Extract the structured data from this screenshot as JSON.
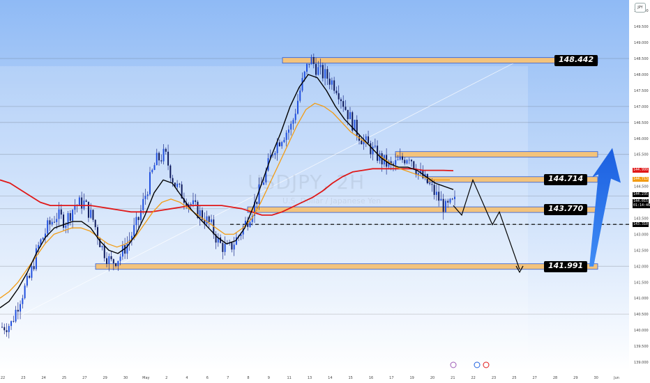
{
  "symbol": "USDJPY, 2H",
  "watermark_sub": "U.S. Dollar / Japanese Yen",
  "currency": "JPY",
  "colors": {
    "bg_top": "#8fbaf5",
    "bg_bottom": "#ffffff",
    "ma_red": "#e01818",
    "ma_orange": "#f39c12",
    "ma_black": "#000000",
    "candle": "#1a2a8a",
    "zone": "#f3c37c",
    "arrow": "#2e7df0"
  },
  "price_axis": [
    "150.000",
    "149.500",
    "149.000",
    "148.500",
    "148.000",
    "147.500",
    "147.000",
    "146.500",
    "146.000",
    "145.500",
    "145.000",
    "144.500",
    "144.000",
    "143.500",
    "143.000",
    "142.500",
    "142.000",
    "141.500",
    "141.000",
    "140.500",
    "140.000",
    "139.500",
    "139.000"
  ],
  "x_labels": [
    "22",
    "23",
    "24",
    "25",
    "27",
    "29",
    "30",
    "May",
    "2",
    "4",
    "6",
    "7",
    "8",
    "9",
    "11",
    "13",
    "14",
    "15",
    "16",
    "17",
    "19",
    "20",
    "21",
    "22",
    "23",
    "25",
    "27",
    "28",
    "29",
    "30",
    "Jun"
  ],
  "badges": [
    {
      "text": "144.999",
      "price": 144.999,
      "color": "#e01818"
    },
    {
      "text": "144.713",
      "price": 144.713,
      "color": "#f39c12"
    },
    {
      "text": "144.235",
      "price": 144.235,
      "color": "#000000"
    },
    {
      "text": "144.015",
      "price": 144.015,
      "color": "#000000"
    },
    {
      "text": "01:14:46",
      "price": 143.9,
      "color": "#000000"
    },
    {
      "text": "143.310",
      "price": 143.31,
      "color": "#000000"
    }
  ],
  "chart_data": {
    "type": "candlestick",
    "title": "USDJPY, 2H",
    "y_unit": "JPY",
    "ylim": [
      139,
      150.2
    ],
    "levels": [
      {
        "label": "148.442",
        "price": 148.442,
        "kind": "resistance"
      },
      {
        "label": "144.714",
        "price": 144.714,
        "kind": "resistance"
      },
      {
        "label": "143.770",
        "price": 143.77,
        "kind": "support"
      },
      {
        "label": "141.991",
        "price": 141.991,
        "kind": "support"
      }
    ],
    "extra_zone_price": 145.5,
    "dashed_level": 143.31,
    "close_path": [
      140.1,
      140.2,
      141.0,
      141.6,
      142.6,
      143.2,
      143.6,
      143.4,
      143.9,
      144.0,
      143.5,
      142.6,
      142.1,
      142.3,
      142.8,
      143.4,
      144.4,
      145.3,
      145.5,
      144.6,
      144.2,
      143.9,
      143.6,
      143.3,
      142.7,
      142.5,
      142.9,
      143.4,
      144.0,
      144.8,
      145.7,
      146.1,
      146.4,
      147.6,
      148.5,
      148.1,
      147.9,
      147.6,
      146.9,
      146.3,
      145.9,
      145.6,
      145.3,
      145.1,
      145.3,
      145.5,
      144.9,
      144.6,
      144.2,
      143.8,
      144.0
    ],
    "ma_black": [
      140.7,
      140.9,
      141.3,
      141.8,
      142.4,
      142.9,
      143.2,
      143.3,
      143.4,
      143.4,
      143.2,
      142.8,
      142.5,
      142.4,
      142.6,
      143.0,
      143.6,
      144.3,
      144.7,
      144.6,
      144.2,
      143.8,
      143.5,
      143.2,
      142.9,
      142.7,
      142.8,
      143.2,
      143.9,
      144.7,
      145.5,
      146.2,
      147.0,
      147.6,
      148.0,
      147.9,
      147.5,
      147.0,
      146.6,
      146.3,
      146.0,
      145.7,
      145.4,
      145.2,
      145.1,
      145.1,
      145.0,
      144.8,
      144.6,
      144.5,
      144.4
    ],
    "ma_orange": [
      141.0,
      141.2,
      141.5,
      141.9,
      142.3,
      142.7,
      143.0,
      143.1,
      143.2,
      143.2,
      143.1,
      142.9,
      142.7,
      142.6,
      142.7,
      142.9,
      143.3,
      143.7,
      144.0,
      144.1,
      144.0,
      143.8,
      143.6,
      143.4,
      143.2,
      143.0,
      143.0,
      143.2,
      143.5,
      144.0,
      144.6,
      145.2,
      145.8,
      146.4,
      146.9,
      147.1,
      147.0,
      146.8,
      146.5,
      146.2,
      146.0,
      145.8,
      145.5,
      145.3,
      145.1,
      145.0,
      144.9,
      144.8,
      144.7,
      144.7,
      144.7
    ],
    "ma_red": [
      144.7,
      144.6,
      144.4,
      144.2,
      144.0,
      143.9,
      143.9,
      143.9,
      143.9,
      143.9,
      143.85,
      143.8,
      143.75,
      143.7,
      143.7,
      143.7,
      143.75,
      143.8,
      143.85,
      143.9,
      143.9,
      143.9,
      143.9,
      143.85,
      143.8,
      143.7,
      143.6,
      143.6,
      143.7,
      143.85,
      144.0,
      144.15,
      144.35,
      144.6,
      144.8,
      144.95,
      145.0,
      145.05,
      145.05,
      145.05,
      145.05,
      145.05,
      145.0,
      145.0,
      145.0,
      144.99
    ],
    "projection": [
      143.9,
      143.6,
      144.7,
      143.3,
      143.7,
      141.9
    ],
    "arrow": {
      "from": 141.99,
      "to": 145.7
    }
  }
}
